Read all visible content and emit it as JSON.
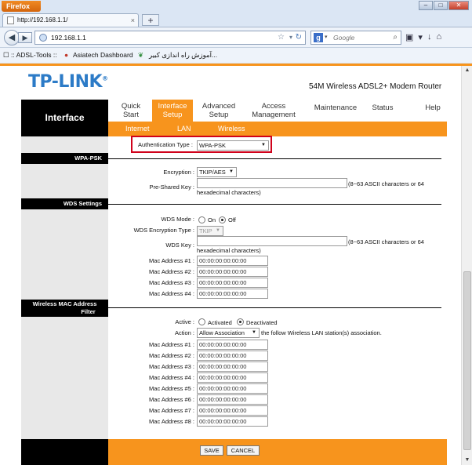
{
  "browser": {
    "app_button": "Firefox",
    "tab_title": "http://192.168.1.1/",
    "tab_close": "×",
    "new_tab": "+",
    "url": "192.168.1.1",
    "search_placeholder": "Google",
    "bookmarks": [
      ":: ADSL-Tools ::",
      "Asiatech Dashboard",
      "آموزش راه اندازی کبیر..."
    ]
  },
  "header": {
    "logo": "TP-LINK",
    "logo_mark": "®",
    "model": "54M Wireless ADSL2+ Modem Router",
    "section_title": "Interface"
  },
  "menu": {
    "items": [
      {
        "l1": "Quick",
        "l2": "Start"
      },
      {
        "l1": "Interface",
        "l2": "Setup"
      },
      {
        "l1": "Advanced",
        "l2": "Setup"
      },
      {
        "l1": "Access",
        "l2": "Management"
      },
      {
        "l1": "Maintenance",
        "l2": ""
      },
      {
        "l1": "Status",
        "l2": ""
      },
      {
        "l1": "Help",
        "l2": ""
      }
    ],
    "sub": [
      "Internet",
      "LAN",
      "Wireless"
    ]
  },
  "auth": {
    "label": "Authentication Type",
    "value": "WPA-PSK"
  },
  "wpa": {
    "section": "WPA-PSK",
    "encryption_label": "Encryption",
    "encryption_value": "TKIP/AES",
    "psk_label": "Pre-Shared Key",
    "psk_value": "",
    "hint_1": "(8~63 ASCII characters or 64",
    "hint_2": "hexadecimal characters)"
  },
  "wds": {
    "section": "WDS Settings",
    "mode_label": "WDS Mode",
    "on": "On",
    "off": "Off",
    "enc_label": "WDS Encryption Type",
    "enc_value": "TKIP",
    "key_label": "WDS Key",
    "key_value": "",
    "hint_1": "(8~63 ASCII characters or 64",
    "hint_2": "hexadecimal characters)",
    "macs": [
      {
        "label": "Mac Address #1",
        "value": "00:00:00:00:00:00"
      },
      {
        "label": "Mac Address #2",
        "value": "00:00:00:00:00:00"
      },
      {
        "label": "Mac Address #3",
        "value": "00:00:00:00:00:00"
      },
      {
        "label": "Mac Address #4",
        "value": "00:00:00:00:00:00"
      }
    ]
  },
  "mac_filter": {
    "section_1": "Wireless MAC Address",
    "section_2": "Filter",
    "active_label": "Active",
    "activated": "Activated",
    "deactivated": "Deactivated",
    "action_label": "Action",
    "action_value": "Allow Association",
    "action_suffix": "the follow Wireless LAN station(s) association.",
    "macs": [
      {
        "label": "Mac Address #1",
        "value": "00:00:00:00:00:00"
      },
      {
        "label": "Mac Address #2",
        "value": "00:00:00:00:00:00"
      },
      {
        "label": "Mac Address #3",
        "value": "00:00:00:00:00:00"
      },
      {
        "label": "Mac Address #4",
        "value": "00:00:00:00:00:00"
      },
      {
        "label": "Mac Address #5",
        "value": "00:00:00:00:00:00"
      },
      {
        "label": "Mac Address #6",
        "value": "00:00:00:00:00:00"
      },
      {
        "label": "Mac Address #7",
        "value": "00:00:00:00:00:00"
      },
      {
        "label": "Mac Address #8",
        "value": "00:00:00:00:00:00"
      }
    ]
  },
  "buttons": {
    "save": "SAVE",
    "cancel": "CANCEL"
  },
  "colors": {
    "accent": "#f7941d",
    "logo": "#2c7bc7",
    "highlight": "#d0021b"
  }
}
